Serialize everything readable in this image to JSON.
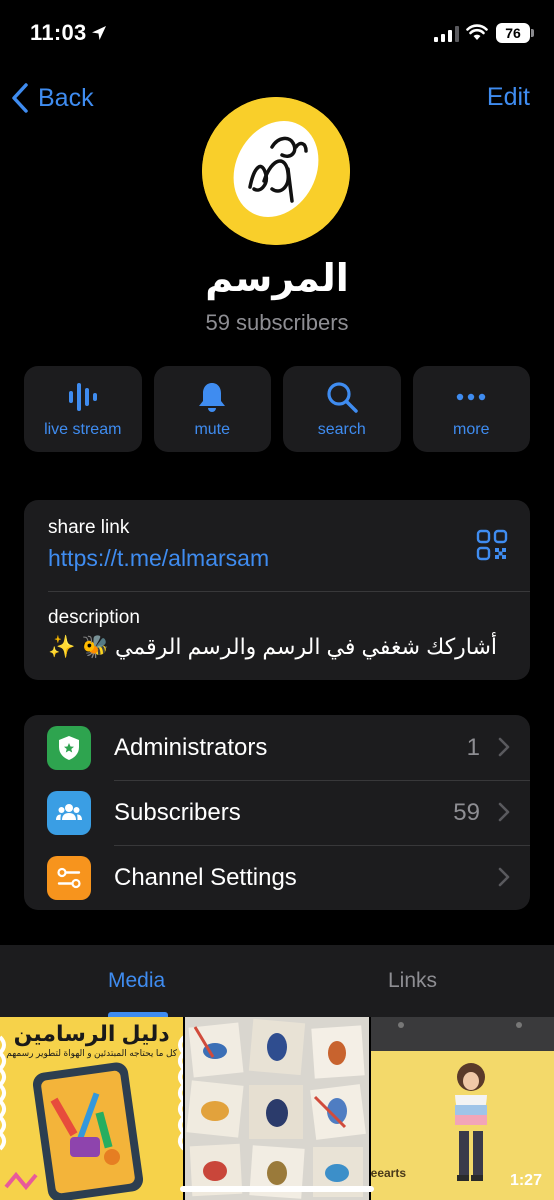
{
  "status_bar": {
    "time": "11:03",
    "battery": "76"
  },
  "nav": {
    "back_label": "Back",
    "edit_label": "Edit"
  },
  "channel": {
    "name": "المرسم",
    "subscribers": "59 subscribers"
  },
  "actions": [
    {
      "label": "live stream",
      "icon": "waveform-icon"
    },
    {
      "label": "mute",
      "icon": "bell-icon"
    },
    {
      "label": "search",
      "icon": "search-icon"
    },
    {
      "label": "more",
      "icon": "ellipsis-icon"
    }
  ],
  "info": {
    "share_label": "share link",
    "share_url": "https://t.me/almarsam",
    "description_label": "description",
    "description_text": "أشاركك شغفي في الرسم والرسم الرقمي 🐝 ✨"
  },
  "list": [
    {
      "label": "Administrators",
      "value": "1",
      "icon": "shield-icon",
      "color": "#2ea44f"
    },
    {
      "label": "Subscribers",
      "value": "59",
      "icon": "people-icon",
      "color": "#3a9ee4"
    },
    {
      "label": "Channel Settings",
      "value": "",
      "icon": "sliders-icon",
      "color": "#f7941d"
    }
  ],
  "tabs": {
    "media": "Media",
    "links": "Links"
  },
  "media": {
    "item1_title": "دليل الرسامين",
    "item1_subtitle": "كل ما يحتاجه المبتدئين و الهواة لتطوير رسمهم",
    "video_duration": "1:27",
    "video_caption": "eearts"
  },
  "colors": {
    "accent": "#3f8cf0",
    "card": "#1c1c1e",
    "secondary_text": "#8e8e93"
  }
}
